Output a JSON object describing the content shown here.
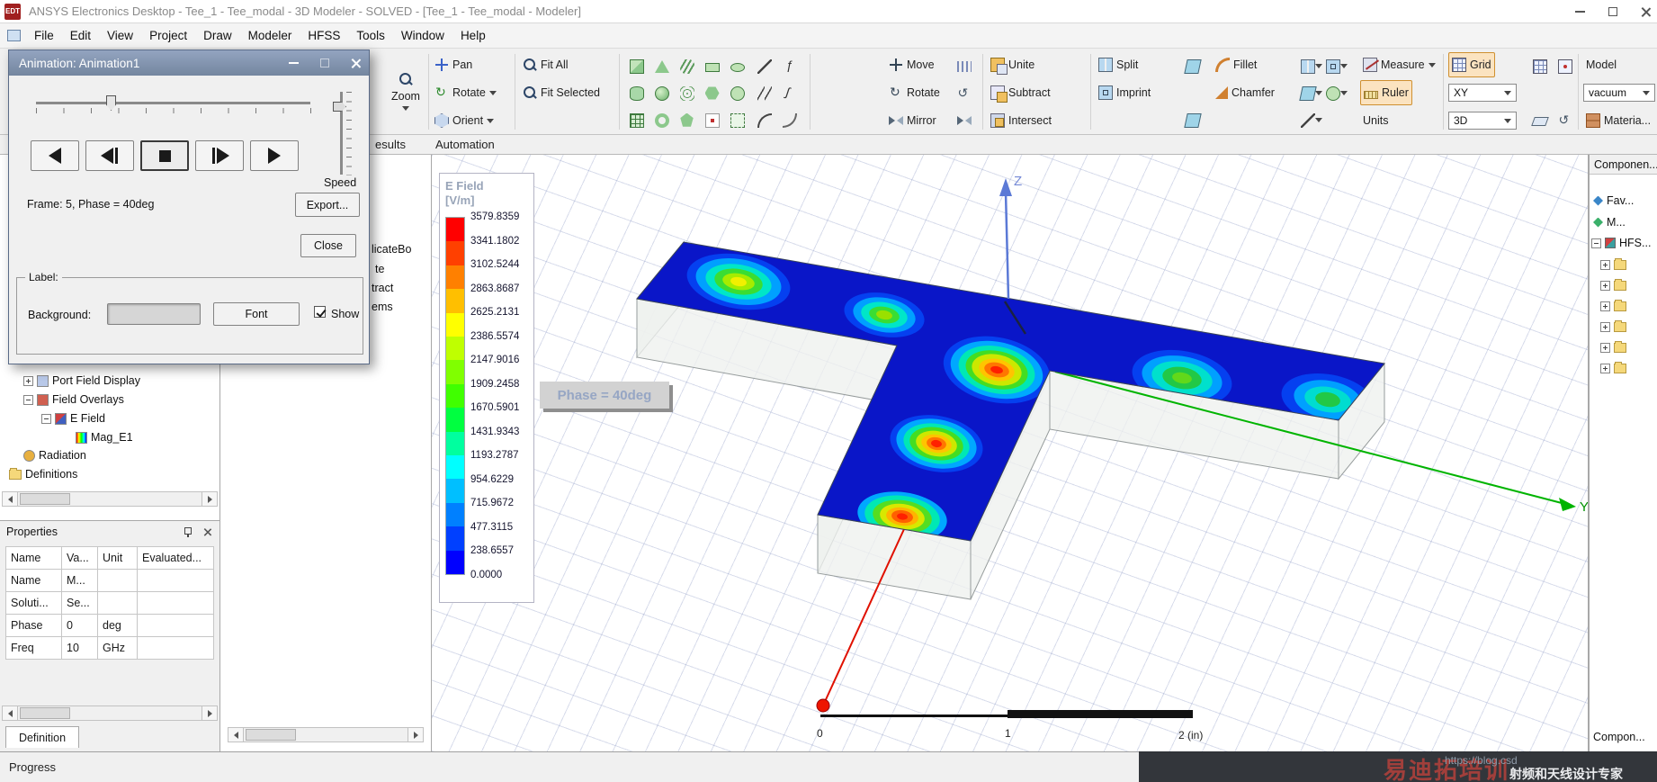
{
  "window": {
    "app_badge": "EDT",
    "title": "ANSYS Electronics Desktop - Tee_1 - Tee_modal - 3D Modeler - SOLVED - [Tee_1 - Tee_modal - Modeler]"
  },
  "menu": {
    "items": [
      "File",
      "Edit",
      "View",
      "Project",
      "Draw",
      "Modeler",
      "HFSS",
      "Tools",
      "Window",
      "Help"
    ]
  },
  "toolbar": {
    "zoom": "Zoom",
    "pan": "Pan",
    "rotate_view": "Rotate",
    "orient": "Orient",
    "fit_all": "Fit All",
    "fit_selected": "Fit Selected",
    "move": "Move",
    "rotate_op": "Rotate",
    "mirror": "Mirror",
    "unite": "Unite",
    "subtract": "Subtract",
    "intersect": "Intersect",
    "split": "Split",
    "imprint": "Imprint",
    "fillet": "Fillet",
    "chamfer": "Chamfer",
    "measure": "Measure",
    "ruler": "Ruler",
    "units": "Units",
    "grid": "Grid",
    "plane": "XY",
    "mode": "3D",
    "model": "Model",
    "material_value": "vacuum",
    "material": "Materia..."
  },
  "dock_tabs": {
    "results": "esults",
    "automation": "Automation"
  },
  "animation_dialog": {
    "title": "Animation: Animation1",
    "frame_info": "Frame: 5, Phase = 40deg",
    "speed": "Speed",
    "export": "Export...",
    "close": "Close",
    "label_section": {
      "title": "Label:",
      "background": "Background:",
      "font": "Font",
      "show": "Show"
    }
  },
  "project_tree": {
    "items": [
      "Port Field Display",
      "Field Overlays",
      "E Field",
      "Mag_E1",
      "Radiation",
      "Definitions"
    ]
  },
  "model_tree_fragments": {
    "f0": "licateBo",
    "f1": "te",
    "f2": "tract",
    "f3": "ems"
  },
  "properties": {
    "title": "Properties",
    "header": [
      "Name",
      "Va...",
      "Unit",
      "Evaluated..."
    ],
    "rows": [
      [
        "Name",
        "M...",
        "",
        ""
      ],
      [
        "Soluti...",
        "Se...",
        "",
        ""
      ],
      [
        "Phase",
        "0",
        "deg",
        ""
      ],
      [
        "Freq",
        "10",
        "GHz",
        ""
      ]
    ],
    "tab": "Definition"
  },
  "scene": {
    "legend_title1": "E Field",
    "legend_title2": "[V/m]",
    "legend_values": [
      "3579.8359",
      "3341.1802",
      "3102.5244",
      "2863.8687",
      "2625.2131",
      "2386.5574",
      "2147.9016",
      "1909.2458",
      "1670.5901",
      "1431.9343",
      "1193.2787",
      "954.6229",
      "715.9672",
      "477.3115",
      "238.6557",
      "0.0000"
    ],
    "legend_colors": [
      "#ff0000",
      "#ff4000",
      "#ff8000",
      "#ffbf00",
      "#ffff00",
      "#bfff00",
      "#80ff00",
      "#40ff00",
      "#00ff40",
      "#00ff9f",
      "#00ffff",
      "#00bfff",
      "#0080ff",
      "#0040ff",
      "#0000ff"
    ],
    "phase_label": "Phase = 40deg",
    "axis_z": "Z",
    "axis_y": "Y",
    "ruler_ticks": [
      "0",
      "1",
      "2 (in)"
    ]
  },
  "components": {
    "top_tab": "Componen...",
    "items": [
      "Fav...",
      "M...",
      "HFS..."
    ],
    "bottom_tab": "Compon..."
  },
  "status": {
    "progress": "Progress"
  },
  "watermark": {
    "url": "https://blog.csd",
    "slogan": "射频和天线设计专家",
    "brand": "易迪拓培训"
  }
}
